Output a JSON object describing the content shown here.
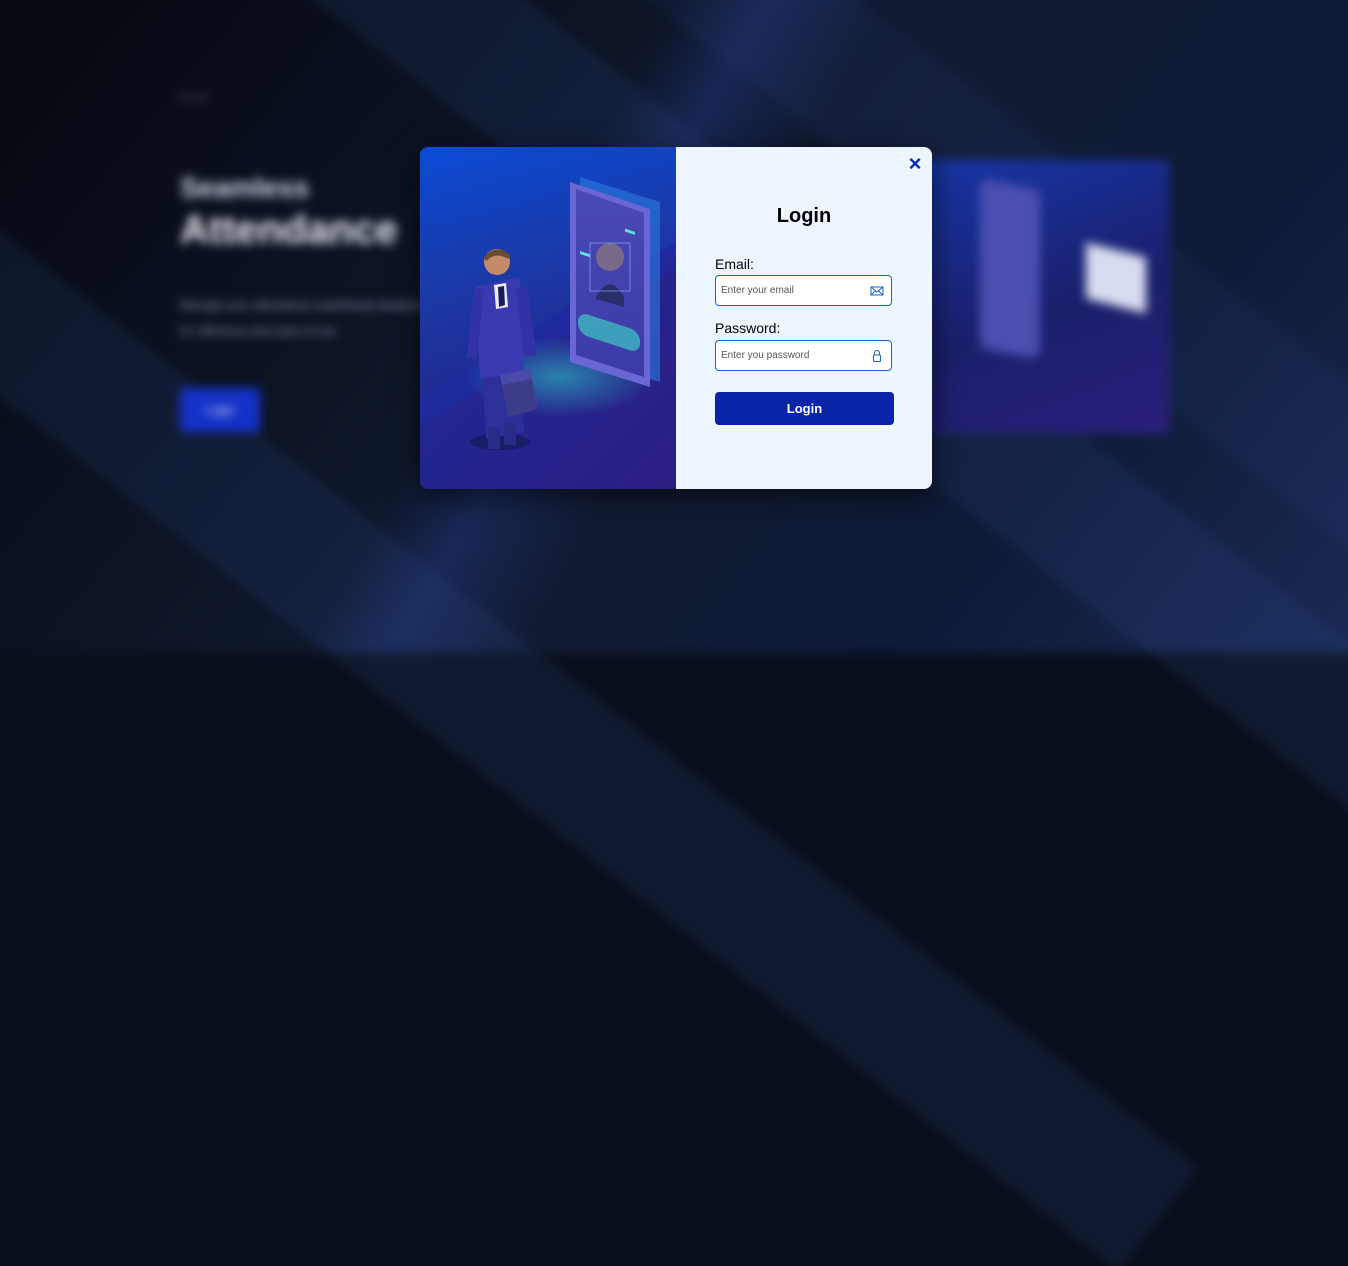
{
  "background": {
    "tag": "• • •",
    "heading_line1": "Seamless",
    "heading_line2": "Attendance",
    "description": "Manage your attendance seamlessly designed for efficiency and ease of use",
    "button_label": "Login"
  },
  "modal": {
    "close_label": "×",
    "title": "Login",
    "email": {
      "label": "Email:",
      "placeholder": "Enter your email",
      "value": "",
      "icon": "envelope-icon"
    },
    "password": {
      "label": "Password:",
      "placeholder": "Enter you password",
      "value": "",
      "icon": "lock-icon"
    },
    "submit_label": "Login"
  },
  "colors": {
    "accent": "#0a24a8",
    "input_border": "#1a64c8",
    "panel_bg": "#edf5ff"
  }
}
